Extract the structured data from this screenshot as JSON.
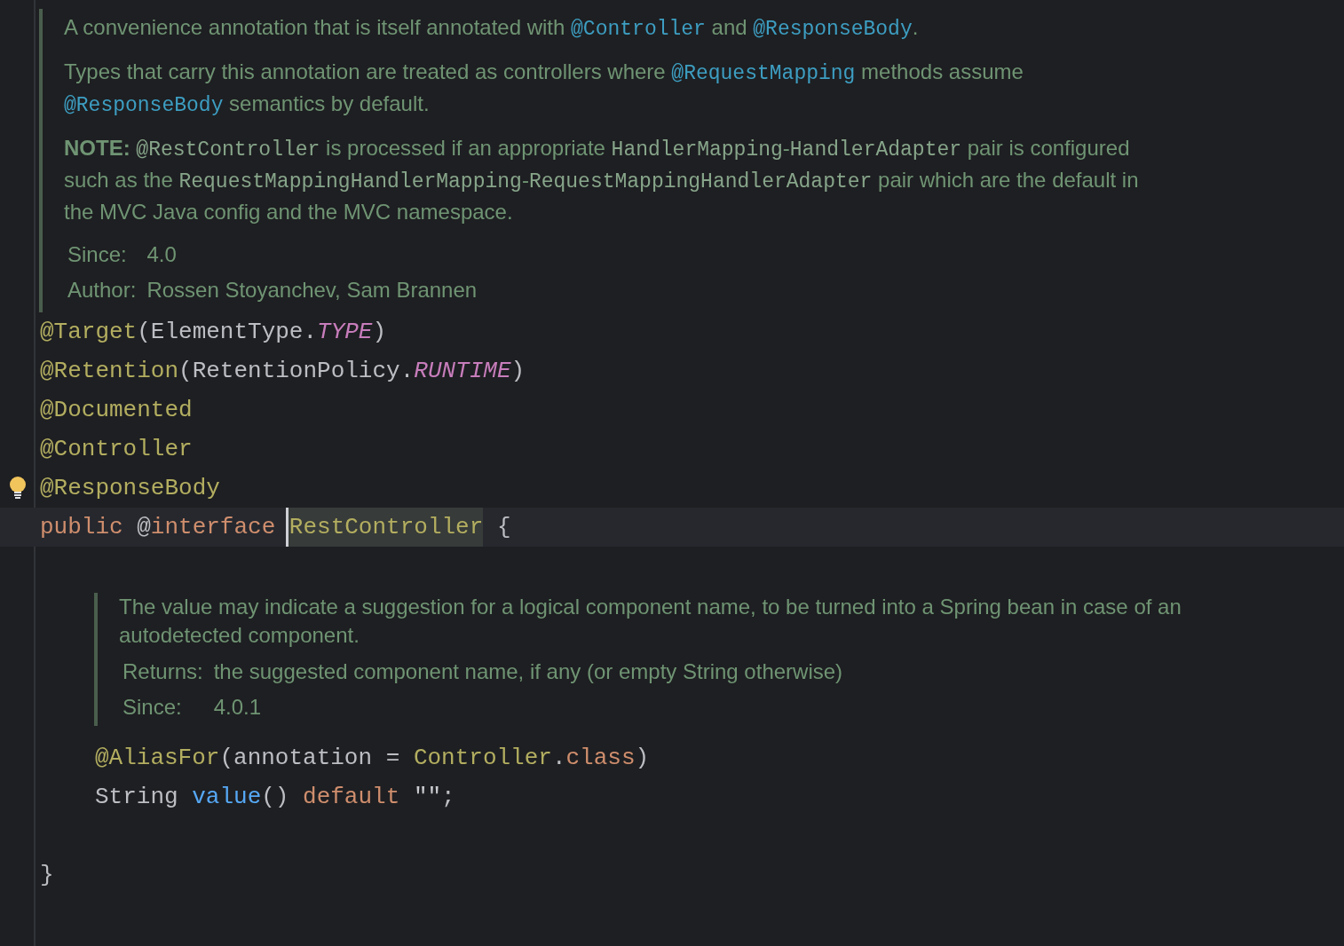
{
  "class_doc": {
    "paragraphs": [
      [
        {
          "kind": "text",
          "text": "A convenience annotation that is itself annotated with "
        },
        {
          "kind": "link",
          "text": "@Controller"
        },
        {
          "kind": "text",
          "text": " and "
        },
        {
          "kind": "link",
          "text": "@ResponseBody"
        },
        {
          "kind": "text",
          "text": "."
        }
      ],
      [
        {
          "kind": "text",
          "text": "Types that carry this annotation are treated as controllers where "
        },
        {
          "kind": "link",
          "text": "@RequestMapping"
        },
        {
          "kind": "text",
          "text": " methods assume "
        },
        {
          "kind": "link",
          "text": "@ResponseBody"
        },
        {
          "kind": "text",
          "text": " semantics by default."
        }
      ],
      [
        {
          "kind": "text",
          "text": "**NOTE:** "
        },
        {
          "kind": "code",
          "text": "@RestController"
        },
        {
          "kind": "text",
          "text": " is processed if an appropriate "
        },
        {
          "kind": "code",
          "text": "HandlerMapping"
        },
        {
          "kind": "text",
          "text": "-"
        },
        {
          "kind": "code",
          "text": "HandlerAdapter"
        },
        {
          "kind": "text",
          "text": " pair is configured such as the "
        },
        {
          "kind": "code",
          "text": "RequestMappingHandlerMapping"
        },
        {
          "kind": "text",
          "text": "-"
        },
        {
          "kind": "code",
          "text": "RequestMappingHandlerAdapter"
        },
        {
          "kind": "text",
          "text": " pair which are the default in the MVC Java config and the MVC namespace."
        }
      ]
    ],
    "fields": [
      {
        "label": "Since:",
        "value": "4.0"
      },
      {
        "label": "Author:",
        "value": "Rossen Stoyanchev, Sam Brannen"
      }
    ]
  },
  "annotations": [
    {
      "bulb": false,
      "tokens": [
        {
          "kind": "annotation",
          "text": "@Target"
        },
        {
          "kind": "plain",
          "text": "(ElementType."
        },
        {
          "kind": "constant",
          "text": "TYPE"
        },
        {
          "kind": "plain",
          "text": ")"
        }
      ]
    },
    {
      "bulb": false,
      "tokens": [
        {
          "kind": "annotation",
          "text": "@Retention"
        },
        {
          "kind": "plain",
          "text": "(RetentionPolicy."
        },
        {
          "kind": "constant",
          "text": "RUNTIME"
        },
        {
          "kind": "plain",
          "text": ")"
        }
      ]
    },
    {
      "bulb": false,
      "tokens": [
        {
          "kind": "annotation",
          "text": "@Documented"
        }
      ]
    },
    {
      "bulb": false,
      "tokens": [
        {
          "kind": "annotation",
          "text": "@Controller"
        }
      ]
    },
    {
      "bulb": true,
      "tokens": [
        {
          "kind": "annotation",
          "text": "@ResponseBody"
        }
      ]
    }
  ],
  "declaration": {
    "current": true,
    "tokens": [
      {
        "kind": "keyword",
        "text": "public "
      },
      {
        "kind": "plain",
        "text": "@"
      },
      {
        "kind": "keyword",
        "text": "interface "
      },
      {
        "kind": "type",
        "text": "RestController",
        "highlighted": true,
        "caret": true
      },
      {
        "kind": "plain",
        "text": " {"
      }
    ],
    "children": [
      {
        "kind": "doc",
        "paragraphs": [
          [
            {
              "kind": "text",
              "text": "The value may indicate a suggestion for a logical component name, to be turned into a Spring bean in case of an autodetected component."
            }
          ]
        ],
        "fields": [
          {
            "label": "Returns:",
            "value": "the suggested component name, if any (or empty String otherwise)"
          },
          {
            "label": "Since:",
            "value": "4.0.1"
          }
        ]
      },
      {
        "kind": "line",
        "tokens": [
          {
            "kind": "annotation",
            "text": "@AliasFor"
          },
          {
            "kind": "plain",
            "text": "(annotation = "
          },
          {
            "kind": "type",
            "text": "Controller"
          },
          {
            "kind": "plain",
            "text": "."
          },
          {
            "kind": "keyword",
            "text": "class"
          },
          {
            "kind": "plain",
            "text": ")"
          }
        ]
      },
      {
        "kind": "line",
        "tokens": [
          {
            "kind": "plain",
            "text": "String "
          },
          {
            "kind": "method",
            "text": "value"
          },
          {
            "kind": "plain",
            "text": "() "
          },
          {
            "kind": "keyword",
            "text": "default "
          },
          {
            "kind": "string",
            "text": "\"\""
          },
          {
            "kind": "plain",
            "text": ";"
          }
        ]
      }
    ]
  },
  "closing": {
    "tokens": [
      {
        "kind": "plain",
        "text": "}"
      }
    ]
  }
}
